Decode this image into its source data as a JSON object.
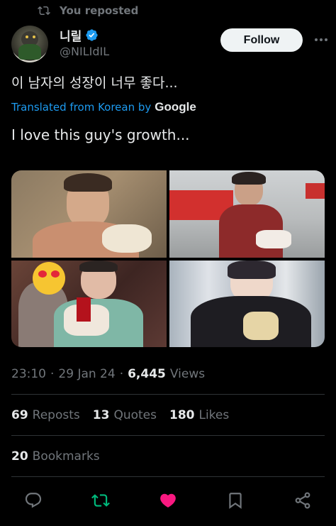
{
  "repost_banner": {
    "text": "You reposted"
  },
  "author": {
    "display_name": "니릴",
    "handle": "@NILIdIL",
    "verified": true
  },
  "follow_button": {
    "label": "Follow"
  },
  "tweet": {
    "text": "이 남자의 성장이 너무 좋다...",
    "translated_label": "Translated from Korean by",
    "translator": "Google",
    "translation": "I love this guy's growth..."
  },
  "meta": {
    "time": "23:10",
    "date": "29 Jan 24",
    "views_count": "6,445",
    "views_label": "Views"
  },
  "stats": {
    "reposts": {
      "count": "69",
      "label": "Reposts"
    },
    "quotes": {
      "count": "13",
      "label": "Quotes"
    },
    "likes": {
      "count": "180",
      "label": "Likes"
    },
    "bookmarks": {
      "count": "20",
      "label": "Bookmarks"
    }
  },
  "icons": {
    "repost_banner": "repost-icon",
    "verified": "verified-badge-icon",
    "reply": "reply-icon",
    "repost": "repost-icon",
    "like": "heart-icon",
    "bookmark": "bookmark-icon",
    "share": "share-icon"
  },
  "colors": {
    "background": "#000000",
    "text_primary": "#e7e9ea",
    "text_secondary": "#71767b",
    "accent_blue": "#1d9bf0",
    "repost_green": "#00ba7c",
    "like_pink": "#f91880",
    "divider": "#2f3336"
  }
}
